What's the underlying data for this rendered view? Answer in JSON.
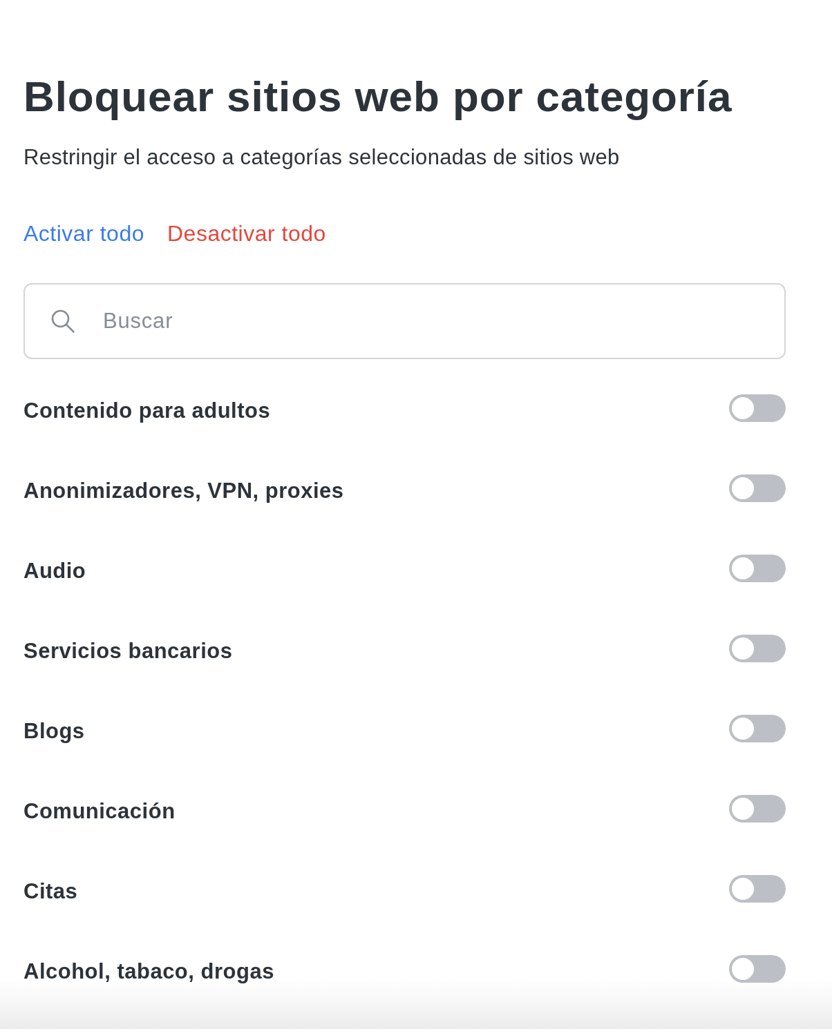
{
  "title": "Bloquear sitios web por categoría",
  "subtitle": "Restringir el acceso a categorías seleccionadas de sitios web",
  "actions": [
    {
      "label": "Activar todo",
      "kind": "enable"
    },
    {
      "label": "Desactivar todo",
      "kind": "disable"
    }
  ],
  "search": {
    "placeholder": "Buscar"
  },
  "categories": [
    {
      "name": "Contenido para adultos",
      "on": false
    },
    {
      "name": "Anonimizadores, VPN, proxies",
      "on": false
    },
    {
      "name": "Audio",
      "on": false
    },
    {
      "name": "Servicios bancarios",
      "on": false
    },
    {
      "name": "Blogs",
      "on": false
    },
    {
      "name": "Comunicación",
      "on": false
    },
    {
      "name": "Citas",
      "on": false
    },
    {
      "name": "Alcohol, tabaco, drogas",
      "on": false
    }
  ]
}
